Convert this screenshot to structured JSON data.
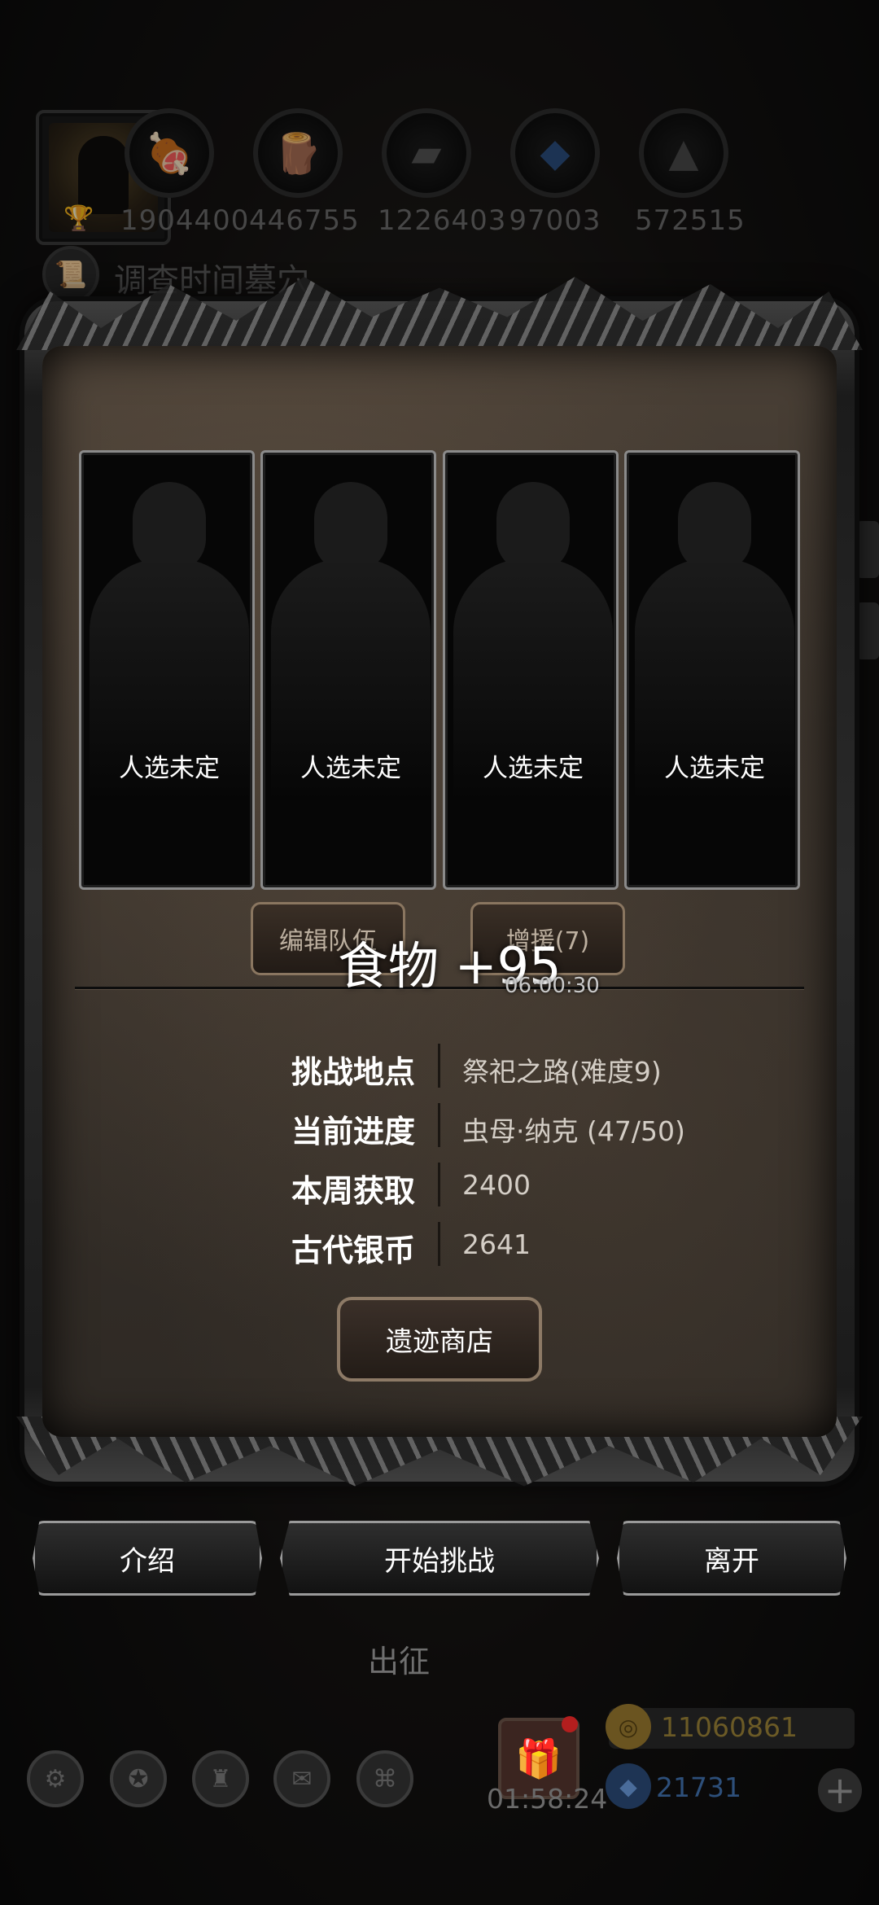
{
  "top_bar": {
    "resources": [
      {
        "icon": "food-icon",
        "value": "1904400"
      },
      {
        "icon": "wood-icon",
        "value": "446755"
      },
      {
        "icon": "iron-icon",
        "value": "1226403"
      },
      {
        "icon": "crystal-icon",
        "value": "97003"
      },
      {
        "icon": "stone-icon",
        "value": "572515"
      }
    ],
    "quest_text": "调查时间墓穴"
  },
  "panel": {
    "slots": [
      {
        "label": "人选未定"
      },
      {
        "label": "人选未定"
      },
      {
        "label": "人选未定"
      },
      {
        "label": "人选未定"
      }
    ],
    "edit_team_label": "编辑队伍",
    "reinforce_label": "增援(7)",
    "float_text": "食物 +95",
    "reinforce_timer": "06:00:30",
    "info": [
      {
        "label": "挑战地点",
        "value": "祭祀之路(难度9)"
      },
      {
        "label": "当前进度",
        "value": "虫母·纳克 (47/50)"
      },
      {
        "label": "本周获取",
        "value": "2400"
      },
      {
        "label": "古代银币",
        "value": "2641"
      }
    ],
    "shop_label": "遗迹商店"
  },
  "actions": {
    "intro": "介绍",
    "start": "开始挑战",
    "leave": "离开"
  },
  "bottom_bar": {
    "sortie": "出征",
    "gift_timer": "01:58:24",
    "gold": "11060861",
    "gems": "21731"
  },
  "colors": {
    "gold_text": "#6b5a26",
    "gem_text": "#2d4f7a"
  }
}
